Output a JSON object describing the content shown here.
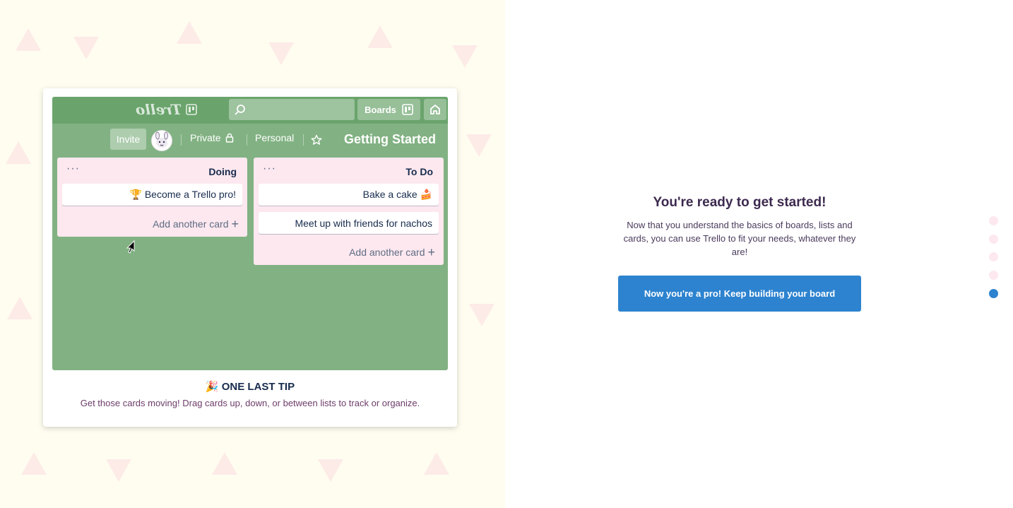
{
  "topbar": {
    "boards_label": "Boards",
    "logo_text": "Trello"
  },
  "board": {
    "title": "Getting Started",
    "team": "Personal",
    "visibility": "Private",
    "invite_label": "Invite"
  },
  "lists": [
    {
      "title": "To Do",
      "cards": [
        "Bake a cake 🍰",
        "Meet up with friends for nachos"
      ],
      "add_label": "Add another card"
    },
    {
      "title": "Doing",
      "cards": [
        "🏆 Become a Trello pro!"
      ],
      "add_label": "Add another card"
    }
  ],
  "tip": {
    "title": "🎉 ONE LAST TIP",
    "text": "Get those cards moving! Drag cards up, down, or between lists to track or organize."
  },
  "panel": {
    "title": "You're ready to get started!",
    "text": "Now that you understand the basics of boards, lists and cards, you can use Trello to fit your needs, whatever they are!",
    "button_label": "Now you're a pro! Keep building your board"
  },
  "pagination": {
    "total": 5,
    "active": 5
  },
  "colors": {
    "board_bg": "#82b283",
    "topbar_bg": "#6aa46c",
    "list_bg": "#fde8ef",
    "accent": "#2d83cf",
    "left_bg": "#fffdf0"
  }
}
